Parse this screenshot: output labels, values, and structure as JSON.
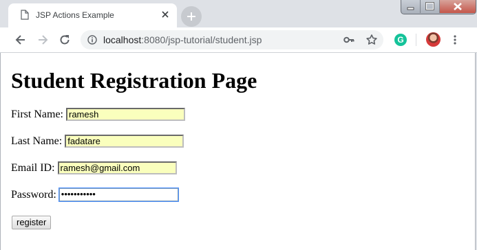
{
  "browser": {
    "tab_title": "JSP Actions Example",
    "url_host": "localhost",
    "url_rest": ":8080/jsp-tutorial/student.jsp",
    "extension_letter": "G"
  },
  "page": {
    "heading": "Student Registration Page",
    "fields": [
      {
        "label": "First Name:",
        "value": "ramesh"
      },
      {
        "label": "Last Name:",
        "value": "fadatare"
      },
      {
        "label": "Email ID:",
        "value": "ramesh@gmail.com"
      },
      {
        "label": "Password:",
        "value": "•••••••••••"
      }
    ],
    "submit_label": "register"
  },
  "colors": {
    "autofill_bg": "#faffbd",
    "grammarly": "#15c39a",
    "focus_ring": "#4d90fe"
  }
}
